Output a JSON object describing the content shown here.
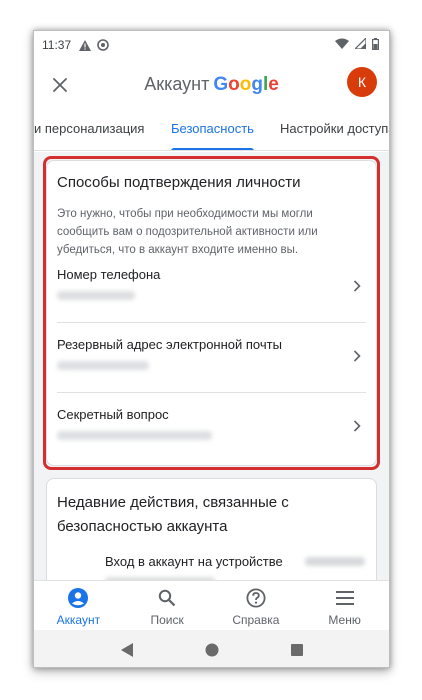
{
  "status_bar": {
    "time": "11:37",
    "icons_left": [
      "warning-icon",
      "data-saver-icon"
    ],
    "icons_right": [
      "wifi-icon",
      "cellular-signal-icon",
      "battery-icon"
    ]
  },
  "header": {
    "title_prefix": "Аккаунт",
    "title_brand": [
      "G",
      "o",
      "o",
      "g",
      "l",
      "e"
    ],
    "avatar_letter": "К",
    "close_icon": "close-icon"
  },
  "tabs": [
    {
      "label": "и персонализация",
      "active": false
    },
    {
      "label": "Безопасность",
      "active": true
    },
    {
      "label": "Настройки доступа",
      "active": false
    }
  ],
  "identity_card": {
    "title": "Способы подтверждения личности",
    "description": "Это нужно, чтобы при необходимости мы могли сообщить вам о подозрительной активности или убедиться, что в аккаунт входите именно вы.",
    "rows": [
      {
        "label": "Номер телефона"
      },
      {
        "label": "Резервный адрес электронной почты"
      },
      {
        "label": "Секретный вопрос"
      }
    ],
    "highlight_color": "#d32f2f"
  },
  "activity_card": {
    "title": "Недавние действия, связанные с безопасностью аккаунта",
    "event_text": "Вход в аккаунт на устройстве"
  },
  "bottom_nav": [
    {
      "label": "Аккаунт",
      "icon": "account-circle-icon",
      "active": true
    },
    {
      "label": "Поиск",
      "icon": "search-icon",
      "active": false
    },
    {
      "label": "Справка",
      "icon": "help-icon",
      "active": false
    },
    {
      "label": "Меню",
      "icon": "menu-icon",
      "active": false
    }
  ],
  "colors": {
    "accent": "#1a73e8",
    "avatar_bg": "#d93c0b",
    "highlight": "#d32f2f"
  }
}
